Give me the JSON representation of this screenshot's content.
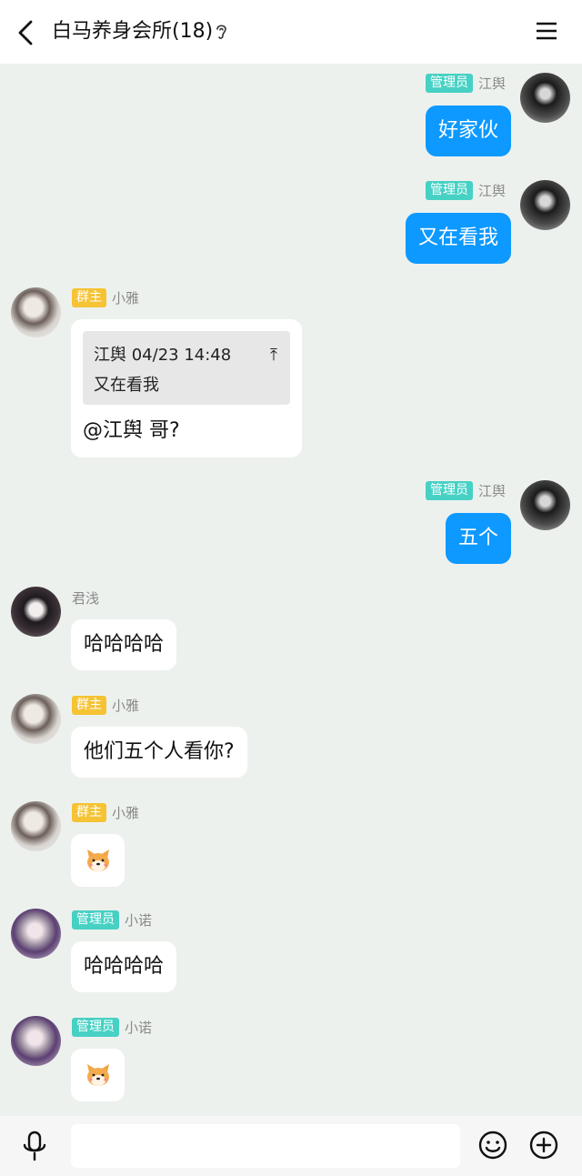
{
  "header": {
    "title": "白马养身会所(18)"
  },
  "messages": [
    {
      "sender": "江舆",
      "role": "管理员",
      "text": "好家伙"
    },
    {
      "sender": "江舆",
      "role": "管理员",
      "text": "又在看我"
    },
    {
      "sender": "小雅",
      "role": "群主",
      "quote_head": "江舆 04/23 14:48",
      "quote_body": "又在看我",
      "text": "@江舆 哥?"
    },
    {
      "sender": "江舆",
      "role": "管理员",
      "text": "五个"
    },
    {
      "sender": "君浅",
      "text": "哈哈哈哈"
    },
    {
      "sender": "小雅",
      "role": "群主",
      "text": "他们五个人看你?"
    },
    {
      "sender": "小雅",
      "role": "群主",
      "sticker": "dog-face-sticker"
    },
    {
      "sender": "小诺",
      "role": "管理员",
      "text": "哈哈哈哈"
    },
    {
      "sender": "小诺",
      "role": "管理员",
      "sticker": "dog-face-sticker"
    }
  ],
  "input": {
    "value": "",
    "placeholder": ""
  },
  "icons": {
    "back": "chevron-left-icon",
    "ear": "ear-icon",
    "menu": "hamburger-menu-icon",
    "mic": "microphone-icon",
    "emoji": "smiley-face-icon",
    "plus": "plus-circle-icon"
  },
  "colors": {
    "background": "#edf1ee",
    "outgoing_bubble": "#0d99ff",
    "admin_badge": "#47d1c4",
    "owner_badge": "#f5c334"
  }
}
